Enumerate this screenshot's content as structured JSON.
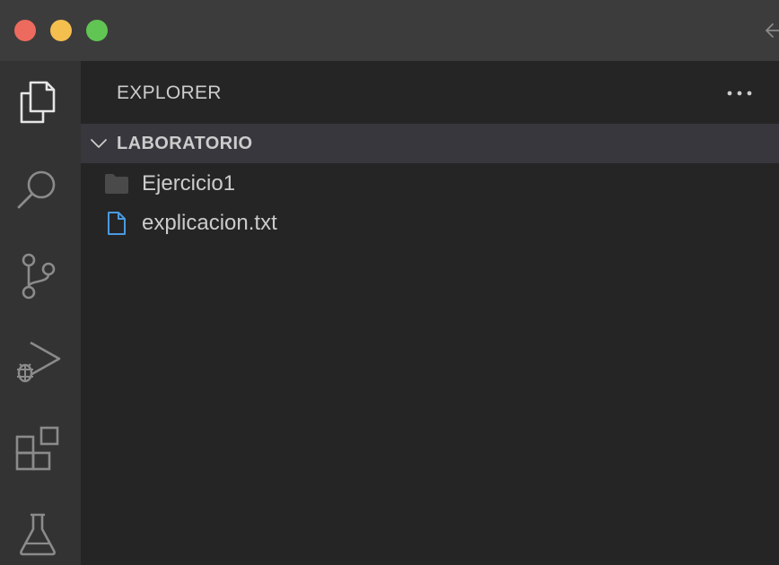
{
  "window": {
    "traffic_lights": {
      "close_color": "#ed6a5e",
      "minimize_color": "#f5bf4f",
      "maximize_color": "#61c554"
    }
  },
  "activity_bar": {
    "items": [
      {
        "icon": "files-icon",
        "active": true
      },
      {
        "icon": "search-icon",
        "active": false
      },
      {
        "icon": "source-control-icon",
        "active": false
      },
      {
        "icon": "run-debug-icon",
        "active": false
      },
      {
        "icon": "extensions-icon",
        "active": false
      },
      {
        "icon": "testing-flask-icon",
        "active": false
      }
    ]
  },
  "sidebar": {
    "title": "EXPLORER",
    "more_actions_icon": "ellipsis-icon",
    "section": {
      "title": "LABORATORIO",
      "expanded": true
    },
    "tree": [
      {
        "label": "Ejercicio1",
        "type": "folder",
        "icon": "folder-icon"
      },
      {
        "label": "explicacion.txt",
        "type": "file",
        "icon": "file-icon"
      }
    ]
  },
  "colors": {
    "titlebar": "#3c3c3c",
    "activity_bar": "#333333",
    "sidebar": "#252526",
    "section_header": "#37373d",
    "text": "#cccccc",
    "file_icon": "#4b9ae0",
    "folder_icon": "#4a4a4a"
  }
}
